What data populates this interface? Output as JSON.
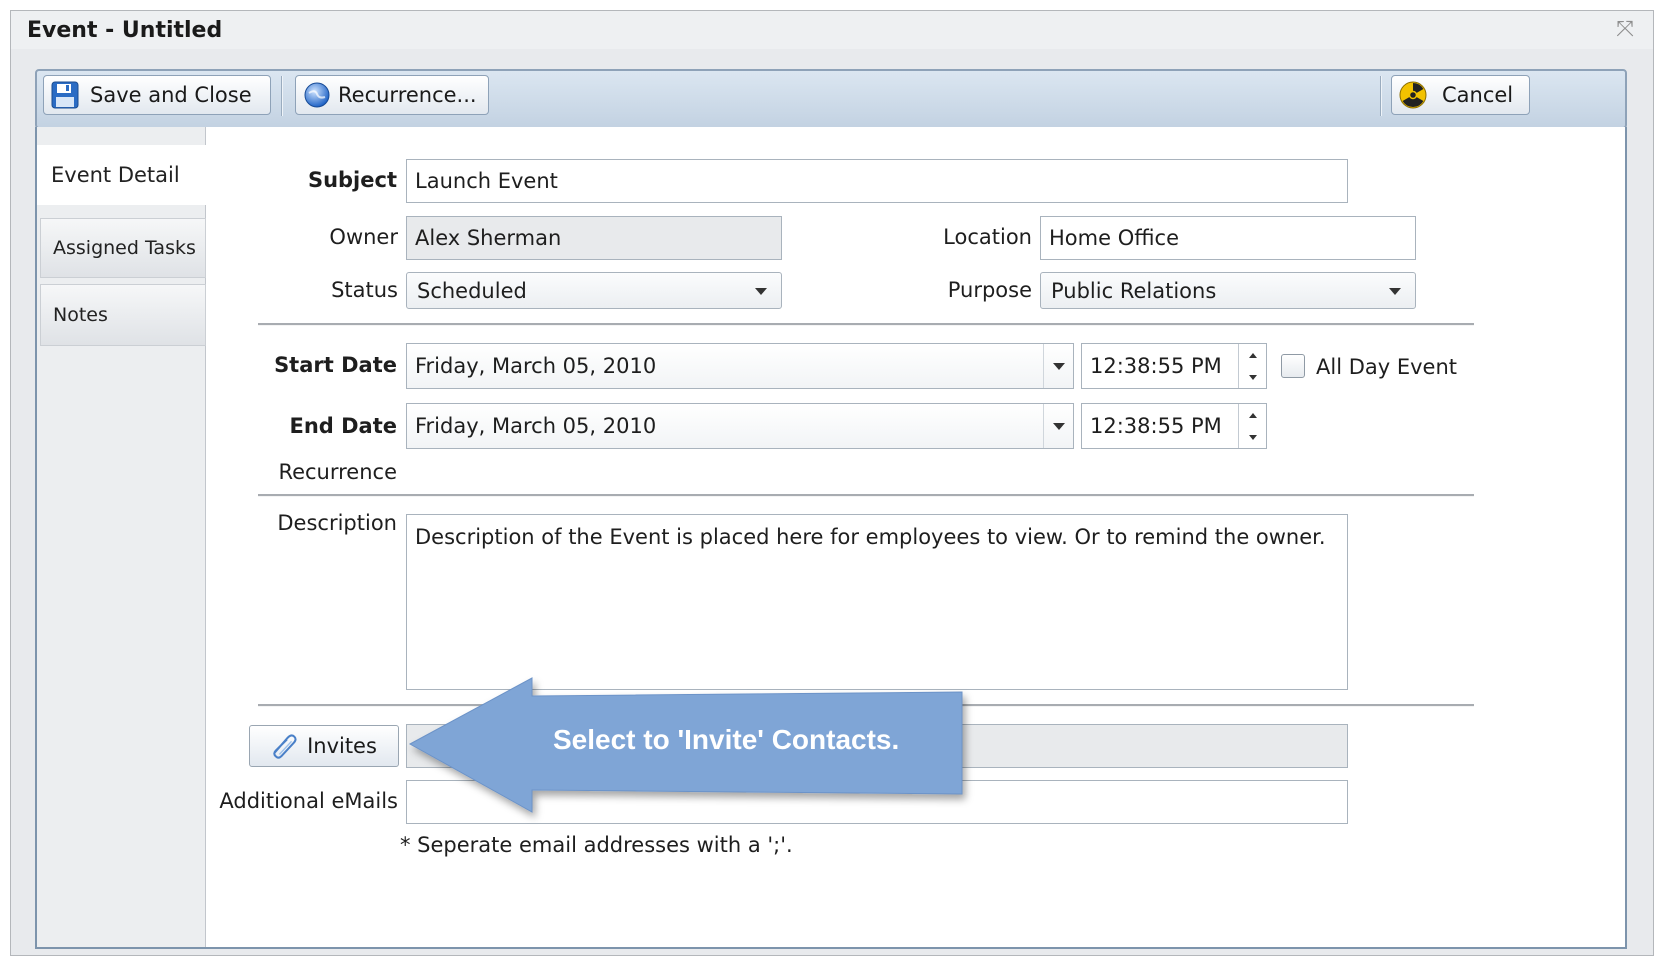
{
  "window": {
    "title": "Event - Untitled",
    "close_glyph": "⤧"
  },
  "toolbar": {
    "save_close_label": "Save and Close",
    "recurrence_label": "Recurrence...",
    "cancel_label": "Cancel",
    "icons": {
      "save": "floppy-disk-icon",
      "recurrence": "globe-icon",
      "cancel": "radiation-icon"
    }
  },
  "nav": {
    "event_detail": "Event Detail",
    "assigned_tasks": "Assigned Tasks",
    "notes": "Notes"
  },
  "form": {
    "subject": {
      "label": "Subject",
      "value": "Launch Event"
    },
    "owner": {
      "label": "Owner",
      "value": "Alex Sherman"
    },
    "location": {
      "label": "Location",
      "value": "Home Office"
    },
    "status": {
      "label": "Status",
      "value": "Scheduled"
    },
    "purpose": {
      "label": "Purpose",
      "value": "Public Relations"
    },
    "start_date": {
      "label": "Start Date",
      "date": "Friday, March 05, 2010",
      "time": "12:38:55 PM"
    },
    "end_date": {
      "label": "End Date",
      "date": "Friday, March 05, 2010",
      "time": "12:38:55 PM"
    },
    "all_day": {
      "label": "All Day Event",
      "checked": false
    },
    "recurrence": {
      "label": "Recurrence"
    },
    "description": {
      "label": "Description",
      "value": "Description of the Event is placed here for employees to view. Or to remind the owner."
    },
    "invites": {
      "label": "Invites",
      "value": ""
    },
    "additional_emails": {
      "label": "Additional eMails",
      "value": ""
    },
    "email_hint": "* Seperate email addresses with a ';'."
  },
  "callout": {
    "text": "Select to 'Invite' Contacts."
  },
  "colors": {
    "callout_fill": "#7fa5d6",
    "toolbar_border": "#8ea2b8",
    "panel_border": "#7d94ac"
  }
}
